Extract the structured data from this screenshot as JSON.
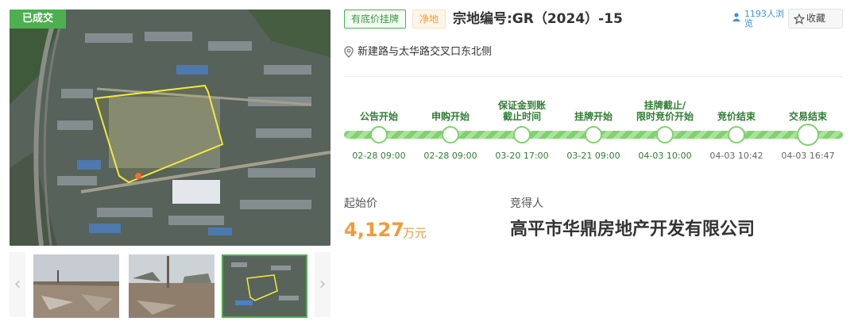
{
  "media": {
    "status_tag": "已成交",
    "thumbnails": [
      "site-photo-1",
      "site-photo-2",
      "satellite-map"
    ]
  },
  "header": {
    "tag_reserve": "有底价挂牌",
    "tag_clean": "净地",
    "title": "宗地编号:GR（2024）-15",
    "views": "1193人浏览",
    "favorite": "收藏"
  },
  "address": "新建路与太华路交叉口东北侧",
  "timeline": {
    "steps": [
      {
        "label": "公告开始",
        "time": "02-28 09:00"
      },
      {
        "label": "申购开始",
        "time": "02-28 09:00"
      },
      {
        "label": "保证金到账\n截止时间",
        "time": "03-20 17:00"
      },
      {
        "label": "挂牌开始",
        "time": "03-21 09:00"
      },
      {
        "label": "挂牌截止/\n限时竞价开始",
        "time": "04-03 10:00"
      },
      {
        "label": "竞价结束",
        "time": "04-03 10:42"
      },
      {
        "label": "交易结束",
        "time": "04-03 16:47"
      }
    ]
  },
  "price": {
    "label": "起始价",
    "value": "4,127",
    "unit": "万元"
  },
  "winner": {
    "label": "竞得人",
    "name": "高平市华鼎房地产开发有限公司"
  },
  "colors": {
    "accent_green": "#4caf50",
    "orange": "#f39b34",
    "link_blue": "#3b8fe0"
  }
}
